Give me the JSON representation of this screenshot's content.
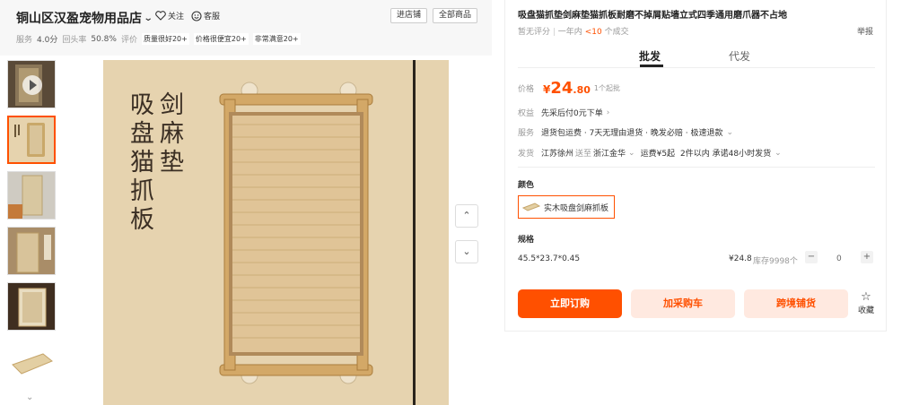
{
  "shop": {
    "name": "铜山区汉盈宠物用品店",
    "follow_label": "关注",
    "service_label": "客服",
    "enter_shop_label": "进店铺",
    "all_goods_label": "全部商品",
    "service_label_stat": "服务",
    "service_score": "4.0分",
    "repurchase_label": "回头率",
    "repurchase_rate": "50.8%",
    "review_label": "评价",
    "badges": [
      "质量很好20+",
      "价格很便宜20+",
      "非常满意20+"
    ]
  },
  "gallery": {
    "main_image_text": [
      "剑麻垫",
      "吸盘猫抓板"
    ],
    "up_label": "⌃",
    "down_label": "⌄"
  },
  "product": {
    "title": "吸盘猫抓垫剑麻垫猫抓板耐磨不掉屑贴墙立式四季通用磨爪器不占地",
    "rating_text": "暂无评分",
    "sales_prefix": "一年内",
    "sales_value": "<10",
    "sales_suffix": "个成交",
    "report_label": "举报",
    "tabs": [
      "批发",
      "代发"
    ],
    "price_label": "价格",
    "price_yen": "¥",
    "price_int": "24",
    "price_dec": ".80",
    "min_order": "1个起批",
    "rights_label": "权益",
    "rights_text": "先采后付0元下单",
    "service_label": "服务",
    "service_text": "退货包运费 · 7天无理由退货 · 晚发必赔 · 极速退款",
    "ship_label": "发货",
    "ship_from": "江苏徐州",
    "ship_to_label": "送至",
    "ship_to": "浙江金华",
    "shipping_fee": "运费¥5起",
    "ship_time": "2件以内  承诺48小时发货",
    "color_label": "颜色",
    "color_option": "实木吸盘剑麻抓板",
    "spec_label": "规格",
    "spec_name": "45.5*23.7*0.45",
    "spec_price": "¥24.8",
    "spec_stock": "库存9998个",
    "qty_minus": "−",
    "qty_value": "0",
    "qty_plus": "+",
    "buy_now": "立即订购",
    "add_cart": "加采购车",
    "cross_border": "跨境铺货",
    "favorite": "收藏"
  },
  "colors": {
    "accent": "#ff5000",
    "accent_light": "#ffe9e0"
  }
}
